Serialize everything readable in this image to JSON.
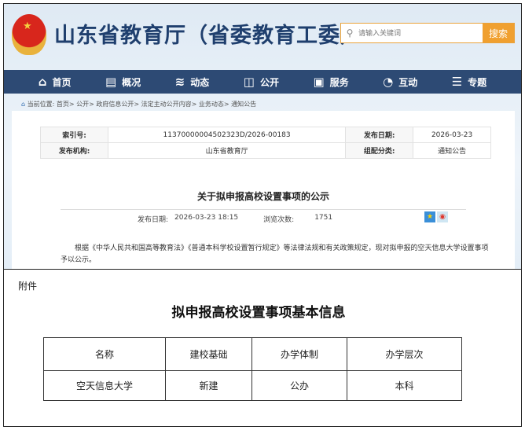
{
  "header": {
    "site_title": "山东省教育厅（省委教育工委）",
    "search_placeholder": "请输入关键词",
    "search_button": "搜索"
  },
  "nav": [
    {
      "icon": "home-icon",
      "glyph": "⌂",
      "label": "首页"
    },
    {
      "icon": "overview-icon",
      "glyph": "▤",
      "label": "概况"
    },
    {
      "icon": "news-icon",
      "glyph": "≋",
      "label": "动态"
    },
    {
      "icon": "book-icon",
      "glyph": "◫",
      "label": "公开"
    },
    {
      "icon": "service-icon",
      "glyph": "▣",
      "label": "服务"
    },
    {
      "icon": "chat-icon",
      "glyph": "◔",
      "label": "互动"
    },
    {
      "icon": "topic-icon",
      "glyph": "☰",
      "label": "专题"
    }
  ],
  "breadcrumb": "当前位置: 首页> 公开> 政府信息公开> 法定主动公开内容> 业务动态> 通知公告",
  "meta": {
    "index_label": "索引号:",
    "index_value": "11370000004502323D/2026-00183",
    "date_label": "发布日期:",
    "date_value": "2026-03-23",
    "org_label": "发布机构:",
    "org_value": "山东省教育厅",
    "cat_label": "组配分类:",
    "cat_value": "通知公告"
  },
  "article": {
    "title": "关于拟申报高校设置事项的公示",
    "pub_label": "发布日期:",
    "pub_value": "2026-03-23 18:15",
    "views_label": "浏览次数:",
    "views_value": "1751",
    "body": "根据《中华人民共和国高等教育法》《普通本科学校设置暂行规定》等法律法规和有关政策规定，现对拟申报的空天信息大学设置事项予以公示。"
  },
  "attachment": {
    "label": "附件",
    "title": "拟申报高校设置事项基本信息",
    "headers": [
      "名称",
      "建校基础",
      "办学体制",
      "办学层次"
    ],
    "rows": [
      [
        "空天信息大学",
        "新建",
        "公办",
        "本科"
      ]
    ]
  }
}
